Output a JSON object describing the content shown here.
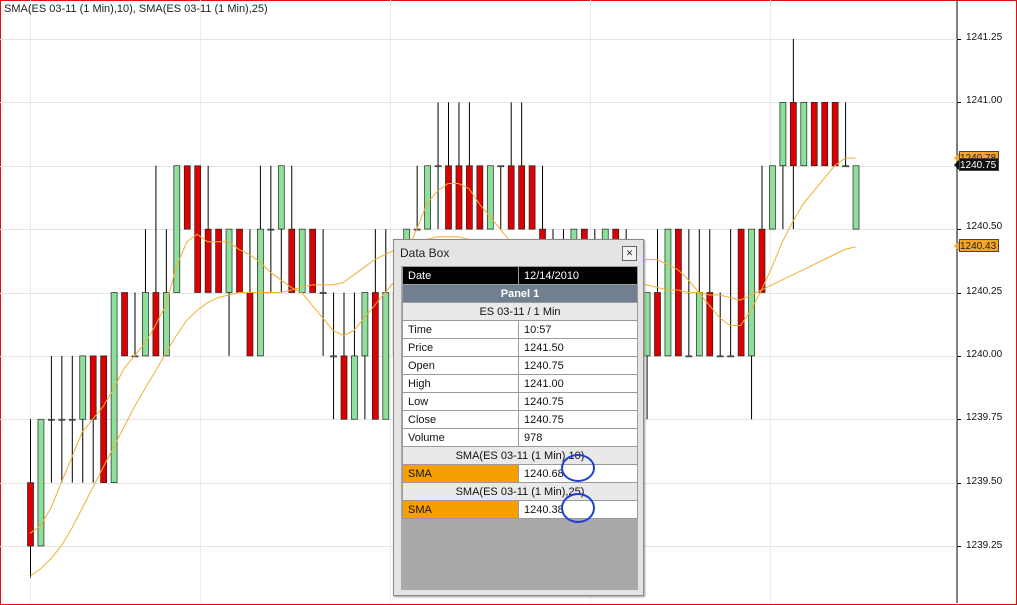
{
  "chart_title": "SMA(ES 03-11 (1 Min),10), SMA(ES 03-11 (1 Min),25)",
  "colors": {
    "up": "#8de09a",
    "down": "#dd0000",
    "sma": "#f0b030",
    "frame": "#e01010"
  },
  "price_axis": {
    "ticks": [
      "1241.25",
      "1241.00",
      "1240.50",
      "1240.25",
      "1240.00",
      "1239.75",
      "1239.50",
      "1239.25"
    ],
    "badges": [
      {
        "label": "1240.78",
        "style": "orange"
      },
      {
        "label": "1240.75",
        "style": "dark"
      },
      {
        "label": "1240.43",
        "style": "orange"
      }
    ]
  },
  "databox": {
    "title": "Data Box",
    "close_icon": "close-icon",
    "date_label": "Date",
    "date_value": "12/14/2010",
    "panel": "Panel 1",
    "instrument": "ES 03-11 / 1 Min",
    "rows": [
      {
        "k": "Time",
        "v": "10:57"
      },
      {
        "k": "Price",
        "v": "1241.50"
      },
      {
        "k": "Open",
        "v": "1240.75"
      },
      {
        "k": "High",
        "v": "1241.00"
      },
      {
        "k": "Low",
        "v": "1240.75"
      },
      {
        "k": "Close",
        "v": "1240.75"
      },
      {
        "k": "Volume",
        "v": "978"
      }
    ],
    "sma1_header": "SMA(ES 03-11 (1 Min),10)",
    "sma1_label": "SMA",
    "sma1_value": "1240.68",
    "sma2_header": "SMA(ES 03-11 (1 Min),25)",
    "sma2_label": "SMA",
    "sma2_value": "1240.38"
  },
  "chart_data": {
    "type": "candlestick",
    "y_range": [
      1239.125,
      1241.375
    ],
    "candles": [
      {
        "o": 1239.5,
        "h": 1239.75,
        "l": 1239.125,
        "c": 1239.25
      },
      {
        "o": 1239.25,
        "h": 1239.75,
        "l": 1239.25,
        "c": 1239.75
      },
      {
        "o": 1239.75,
        "h": 1240,
        "l": 1239.5,
        "c": 1239.75
      },
      {
        "o": 1239.75,
        "h": 1240,
        "l": 1239.5,
        "c": 1239.75
      },
      {
        "o": 1239.75,
        "h": 1240,
        "l": 1239.5,
        "c": 1239.75
      },
      {
        "o": 1239.75,
        "h": 1240,
        "l": 1239.5,
        "c": 1240
      },
      {
        "o": 1240,
        "h": 1240,
        "l": 1239.5,
        "c": 1239.75
      },
      {
        "o": 1240,
        "h": 1240,
        "l": 1239.5,
        "c": 1239.5
      },
      {
        "o": 1239.5,
        "h": 1240.25,
        "l": 1239.5,
        "c": 1240.25
      },
      {
        "o": 1240.25,
        "h": 1240.25,
        "l": 1240,
        "c": 1240
      },
      {
        "o": 1240,
        "h": 1240.25,
        "l": 1240,
        "c": 1240
      },
      {
        "o": 1240,
        "h": 1240.5,
        "l": 1240,
        "c": 1240.25
      },
      {
        "o": 1240.25,
        "h": 1240.75,
        "l": 1240,
        "c": 1240
      },
      {
        "o": 1240,
        "h": 1240.5,
        "l": 1240,
        "c": 1240.25
      },
      {
        "o": 1240.25,
        "h": 1240.75,
        "l": 1240.25,
        "c": 1240.75
      },
      {
        "o": 1240.75,
        "h": 1240.75,
        "l": 1240.5,
        "c": 1240.5
      },
      {
        "o": 1240.75,
        "h": 1240.75,
        "l": 1240.25,
        "c": 1240.25
      },
      {
        "o": 1240.5,
        "h": 1240.75,
        "l": 1240.25,
        "c": 1240.25
      },
      {
        "o": 1240.5,
        "h": 1240.5,
        "l": 1240.25,
        "c": 1240.25
      },
      {
        "o": 1240.25,
        "h": 1240.5,
        "l": 1240,
        "c": 1240.5
      },
      {
        "o": 1240.5,
        "h": 1240.5,
        "l": 1240.25,
        "c": 1240.25
      },
      {
        "o": 1240.25,
        "h": 1240.5,
        "l": 1240,
        "c": 1240
      },
      {
        "o": 1240,
        "h": 1240.75,
        "l": 1240,
        "c": 1240.5
      },
      {
        "o": 1240.5,
        "h": 1240.75,
        "l": 1240.25,
        "c": 1240.5
      },
      {
        "o": 1240.5,
        "h": 1240.75,
        "l": 1240.25,
        "c": 1240.75
      },
      {
        "o": 1240.5,
        "h": 1240.75,
        "l": 1240.25,
        "c": 1240.25
      },
      {
        "o": 1240.25,
        "h": 1240.5,
        "l": 1240.25,
        "c": 1240.5
      },
      {
        "o": 1240.5,
        "h": 1240.5,
        "l": 1240.25,
        "c": 1240.25
      },
      {
        "o": 1240.25,
        "h": 1240.5,
        "l": 1240,
        "c": 1240.25
      },
      {
        "o": 1240,
        "h": 1240.25,
        "l": 1239.75,
        "c": 1240
      },
      {
        "o": 1240,
        "h": 1240.25,
        "l": 1239.75,
        "c": 1239.75
      },
      {
        "o": 1239.75,
        "h": 1240.25,
        "l": 1239.75,
        "c": 1240
      },
      {
        "o": 1240,
        "h": 1240.25,
        "l": 1239.75,
        "c": 1240.25
      },
      {
        "o": 1240.25,
        "h": 1240.5,
        "l": 1239.75,
        "c": 1239.75
      },
      {
        "o": 1239.75,
        "h": 1240.5,
        "l": 1239.75,
        "c": 1240.25
      },
      {
        "o": 1240.25,
        "h": 1240.25,
        "l": 1240,
        "c": 1240
      },
      {
        "o": 1240,
        "h": 1240.5,
        "l": 1240,
        "c": 1240.5
      },
      {
        "o": 1240.5,
        "h": 1240.75,
        "l": 1240.5,
        "c": 1240.5
      },
      {
        "o": 1240.5,
        "h": 1240.75,
        "l": 1240.5,
        "c": 1240.75
      },
      {
        "o": 1240.75,
        "h": 1241,
        "l": 1240.5,
        "c": 1240.75
      },
      {
        "o": 1240.75,
        "h": 1241,
        "l": 1240.5,
        "c": 1240.5
      },
      {
        "o": 1240.75,
        "h": 1241,
        "l": 1240.5,
        "c": 1240.5
      },
      {
        "o": 1240.75,
        "h": 1241,
        "l": 1240.5,
        "c": 1240.5
      },
      {
        "o": 1240.75,
        "h": 1240.75,
        "l": 1240.5,
        "c": 1240.5
      },
      {
        "o": 1240.5,
        "h": 1240.75,
        "l": 1240.5,
        "c": 1240.75
      },
      {
        "o": 1240.75,
        "h": 1240.75,
        "l": 1240.5,
        "c": 1240.75
      },
      {
        "o": 1240.75,
        "h": 1241,
        "l": 1240.5,
        "c": 1240.5
      },
      {
        "o": 1240.75,
        "h": 1241,
        "l": 1240.5,
        "c": 1240.5
      },
      {
        "o": 1240.75,
        "h": 1240.75,
        "l": 1240.5,
        "c": 1240.5
      },
      {
        "o": 1240.5,
        "h": 1240.75,
        "l": 1240.25,
        "c": 1240.25
      },
      {
        "o": 1240.25,
        "h": 1240.5,
        "l": 1240.25,
        "c": 1240.25
      },
      {
        "o": 1240.25,
        "h": 1240.5,
        "l": 1240.25,
        "c": 1240.25
      },
      {
        "o": 1240.25,
        "h": 1240.5,
        "l": 1240.25,
        "c": 1240.5
      },
      {
        "o": 1240.5,
        "h": 1240.5,
        "l": 1240.25,
        "c": 1240.25
      },
      {
        "o": 1240.25,
        "h": 1240.5,
        "l": 1240.25,
        "c": 1240.25
      },
      {
        "o": 1240.25,
        "h": 1240.5,
        "l": 1240.25,
        "c": 1240.5
      },
      {
        "o": 1240.5,
        "h": 1240.5,
        "l": 1240.25,
        "c": 1240.25
      },
      {
        "o": 1240.25,
        "h": 1240.5,
        "l": 1239.75,
        "c": 1240
      },
      {
        "o": 1240,
        "h": 1240.25,
        "l": 1239.75,
        "c": 1240
      },
      {
        "o": 1240,
        "h": 1240.25,
        "l": 1239.75,
        "c": 1240.25
      },
      {
        "o": 1240.25,
        "h": 1240.5,
        "l": 1240,
        "c": 1240
      },
      {
        "o": 1240,
        "h": 1240.5,
        "l": 1240,
        "c": 1240.5
      },
      {
        "o": 1240.5,
        "h": 1240.5,
        "l": 1240,
        "c": 1240
      },
      {
        "o": 1240,
        "h": 1240.5,
        "l": 1240,
        "c": 1240
      },
      {
        "o": 1240,
        "h": 1240.5,
        "l": 1240,
        "c": 1240.25
      },
      {
        "o": 1240.25,
        "h": 1240.5,
        "l": 1240,
        "c": 1240
      },
      {
        "o": 1240,
        "h": 1240.25,
        "l": 1240,
        "c": 1240
      },
      {
        "o": 1240,
        "h": 1240.5,
        "l": 1240,
        "c": 1240
      },
      {
        "o": 1240.5,
        "h": 1240.5,
        "l": 1240,
        "c": 1240
      },
      {
        "o": 1240,
        "h": 1240.5,
        "l": 1239.75,
        "c": 1240.5
      },
      {
        "o": 1240.5,
        "h": 1240.75,
        "l": 1240.25,
        "c": 1240.25
      },
      {
        "o": 1240.5,
        "h": 1240.75,
        "l": 1240.5,
        "c": 1240.75
      },
      {
        "o": 1240.75,
        "h": 1241,
        "l": 1240.5,
        "c": 1241
      },
      {
        "o": 1241,
        "h": 1241.25,
        "l": 1240.5,
        "c": 1240.75
      },
      {
        "o": 1240.75,
        "h": 1241,
        "l": 1240.75,
        "c": 1241
      },
      {
        "o": 1241,
        "h": 1241,
        "l": 1240.75,
        "c": 1240.75
      },
      {
        "o": 1241,
        "h": 1241,
        "l": 1240.75,
        "c": 1240.75
      },
      {
        "o": 1241,
        "h": 1241,
        "l": 1240.75,
        "c": 1240.75
      },
      {
        "o": 1240.75,
        "h": 1241,
        "l": 1240.75,
        "c": 1240.75
      },
      {
        "o": 1240.5,
        "h": 1240.75,
        "l": 1240.5,
        "c": 1240.75
      }
    ],
    "sma10": [
      1239.3,
      1239.33,
      1239.4,
      1239.5,
      1239.6,
      1239.7,
      1239.75,
      1239.8,
      1239.87,
      1239.95,
      1240.0,
      1240.05,
      1240.12,
      1240.2,
      1240.35,
      1240.45,
      1240.48,
      1240.45,
      1240.45,
      1240.45,
      1240.42,
      1240.4,
      1240.37,
      1240.33,
      1240.3,
      1240.27,
      1240.25,
      1240.2,
      1240.15,
      1240.1,
      1240.08,
      1240.1,
      1240.15,
      1240.2,
      1240.25,
      1240.3,
      1240.4,
      1240.5,
      1240.6,
      1240.65,
      1240.68,
      1240.68,
      1240.66,
      1240.6,
      1240.55,
      1240.5,
      1240.45,
      1240.4,
      1240.38,
      1240.35,
      1240.33,
      1240.3,
      1240.27,
      1240.25,
      1240.25,
      1240.27,
      1240.3,
      1240.32,
      1240.35,
      1240.38,
      1240.38,
      1240.36,
      1240.34,
      1240.3,
      1240.25,
      1240.2,
      1240.15,
      1240.12,
      1240.12,
      1240.18,
      1240.26,
      1240.35,
      1240.45,
      1240.53,
      1240.6,
      1240.65,
      1240.7,
      1240.75,
      1240.78,
      1240.78
    ],
    "sma25": [
      1239.13,
      1239.16,
      1239.2,
      1239.25,
      1239.32,
      1239.4,
      1239.48,
      1239.56,
      1239.64,
      1239.72,
      1239.8,
      1239.87,
      1239.94,
      1240.01,
      1240.08,
      1240.14,
      1240.18,
      1240.21,
      1240.23,
      1240.24,
      1240.25,
      1240.25,
      1240.25,
      1240.25,
      1240.25,
      1240.26,
      1240.27,
      1240.28,
      1240.28,
      1240.28,
      1240.29,
      1240.32,
      1240.35,
      1240.38,
      1240.4,
      1240.42,
      1240.44,
      1240.45,
      1240.46,
      1240.47,
      1240.47,
      1240.47,
      1240.46,
      1240.45,
      1240.44,
      1240.43,
      1240.42,
      1240.41,
      1240.4,
      1240.39,
      1240.38,
      1240.36,
      1240.34,
      1240.33,
      1240.32,
      1240.32,
      1240.31,
      1240.3,
      1240.29,
      1240.28,
      1240.27,
      1240.26,
      1240.26,
      1240.25,
      1240.25,
      1240.24,
      1240.24,
      1240.23,
      1240.22,
      1240.24,
      1240.26,
      1240.28,
      1240.3,
      1240.32,
      1240.34,
      1240.36,
      1240.38,
      1240.4,
      1240.42,
      1240.43
    ]
  }
}
